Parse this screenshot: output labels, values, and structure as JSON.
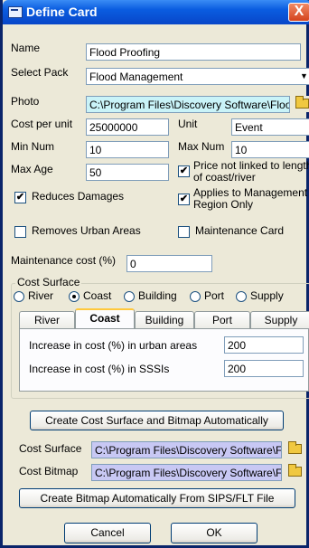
{
  "window": {
    "title": "Define Card",
    "close_glyph": "X"
  },
  "name": {
    "label": "Name",
    "value": "Flood Proofing"
  },
  "pack": {
    "label": "Select Pack",
    "value": "Flood Management"
  },
  "photo": {
    "label": "Photo",
    "value": "C:\\Program Files\\Discovery Software\\Floo"
  },
  "cost": {
    "label": "Cost per unit",
    "value": "25000000"
  },
  "unit": {
    "label": "Unit",
    "value": "Event"
  },
  "min_num": {
    "label": "Min Num",
    "value": "10"
  },
  "max_num": {
    "label": "Max Num",
    "value": "10"
  },
  "max_age": {
    "label": "Max Age",
    "value": "50"
  },
  "checks": {
    "price_not_linked": {
      "label_line1": "Price not linked to length",
      "label_line2": "of coast/river",
      "checked": true,
      "mark": "✔"
    },
    "reduces_damages": {
      "label": "Reduces Damages",
      "checked": true,
      "mark": "✔"
    },
    "applies_mgmt": {
      "label_line1": "Applies to Management",
      "label_line2": "Region Only",
      "checked": true,
      "mark": "✔"
    },
    "removes_urban": {
      "label": "Removes Urban Areas",
      "checked": false
    },
    "maintenance_card": {
      "label": "Maintenance Card",
      "checked": false
    }
  },
  "maintenance_cost": {
    "label": "Maintenance cost (%)",
    "value": "0"
  },
  "cost_surface": {
    "group_title": "Cost Surface",
    "radios": [
      {
        "label": "River",
        "selected": false
      },
      {
        "label": "Coast",
        "selected": true
      },
      {
        "label": "Building",
        "selected": false
      },
      {
        "label": "Port",
        "selected": false
      },
      {
        "label": "Supply",
        "selected": false
      }
    ],
    "tabs": [
      "River",
      "Coast",
      "Building",
      "Port",
      "Supply"
    ],
    "active_tab": "Coast",
    "urban_label": "Increase in cost (%) in urban areas",
    "urban_value": "200",
    "sssi_label": "Increase in cost (%) in SSSIs",
    "sssi_value": "200"
  },
  "buttons": {
    "create_surface": "Create Cost Surface and Bitmap Automatically",
    "create_bitmap": "Create Bitmap Automatically From SIPS/FLT File",
    "cancel": "Cancel",
    "ok": "OK"
  },
  "cost_surface_file": {
    "label": "Cost Surface",
    "value": "C:\\Program Files\\Discovery Software\\Fl"
  },
  "cost_bitmap_file": {
    "label": "Cost Bitmap",
    "value": "C:\\Program Files\\Discovery Software\\Fl"
  },
  "icons": {
    "window": "card-icon",
    "browse": "folder-open-icon",
    "dropdown": "chevron-down-icon"
  },
  "colors": {
    "titlebar": "#0a5ce0",
    "photo_field": "#c9f3f8",
    "file_field": "#c8c8f4",
    "close": "#d4431c"
  }
}
